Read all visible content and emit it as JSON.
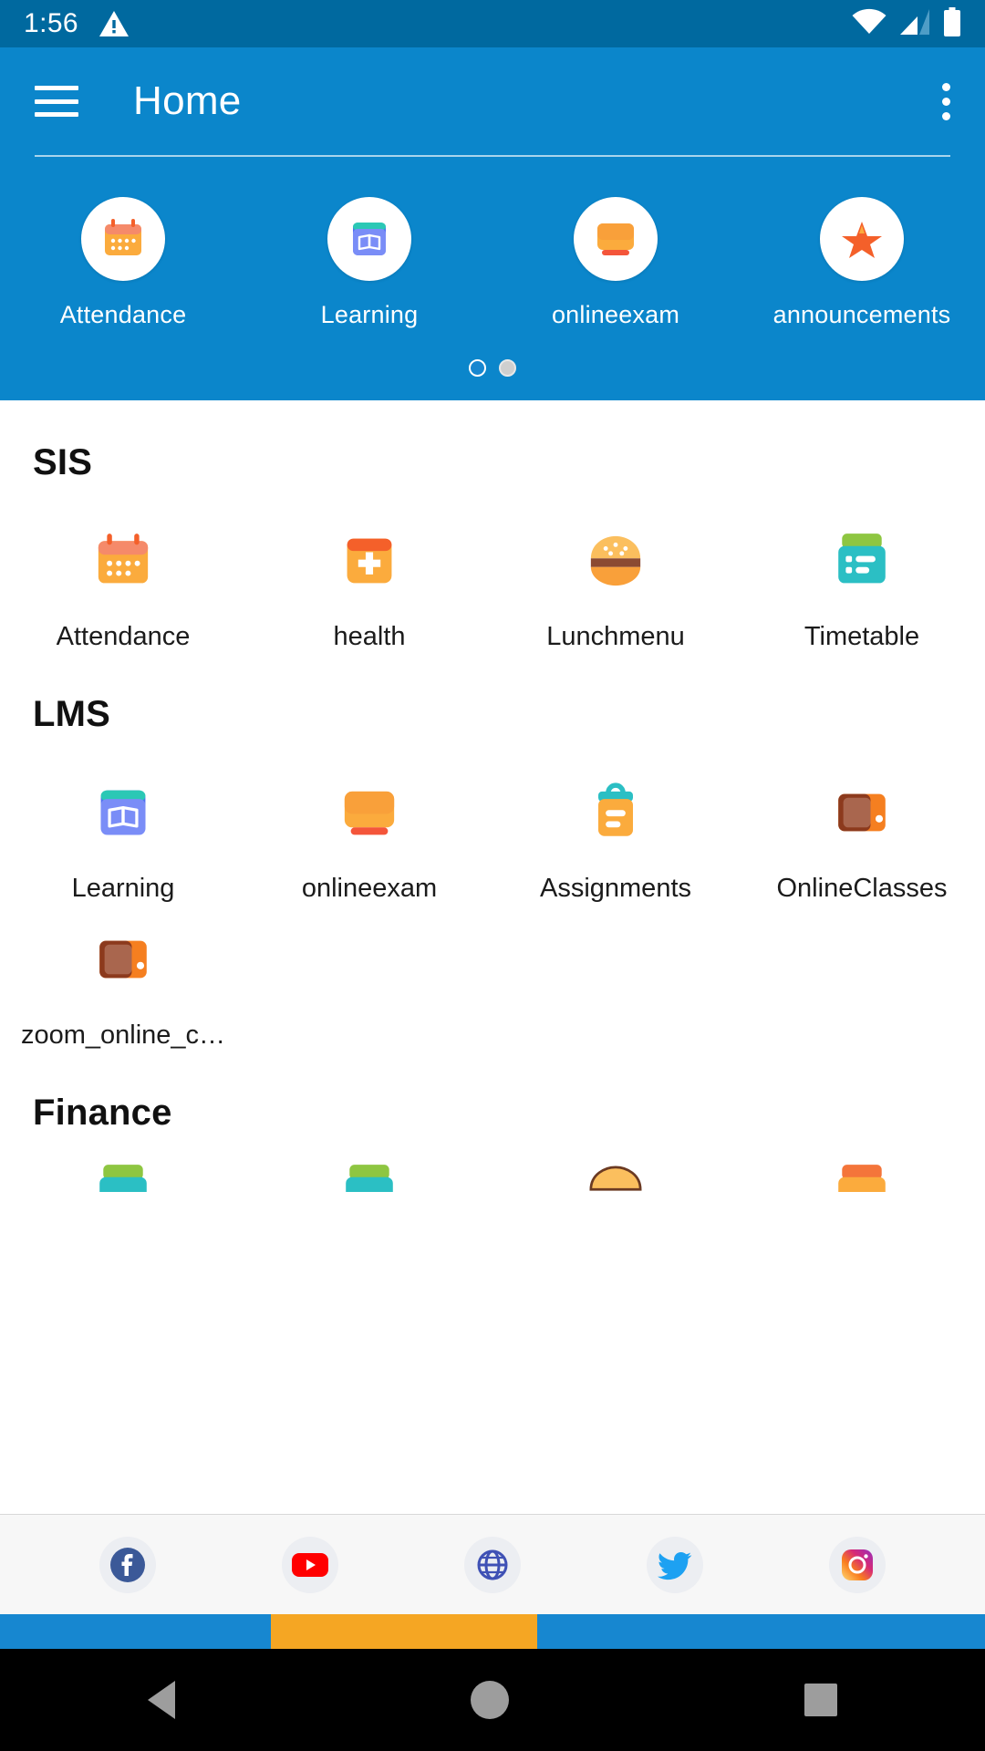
{
  "status_bar": {
    "time": "1:56",
    "icons": [
      "warning-triangle-icon",
      "wifi-icon",
      "signal-icon",
      "battery-icon"
    ],
    "background": "#00699f"
  },
  "app_bar": {
    "title": "Home",
    "menu_icon": "hamburger-menu-icon",
    "overflow_icon": "more-vertical-icon",
    "background": "#0b86cb"
  },
  "carousel": {
    "items": [
      {
        "label": "Attendance",
        "icon": "calendar-icon"
      },
      {
        "label": "Learning",
        "icon": "book-icon"
      },
      {
        "label": "onlineexam",
        "icon": "monitor-icon"
      },
      {
        "label": "announcements",
        "icon": "star-icon"
      }
    ],
    "pager": {
      "count": 2,
      "active_index": 0,
      "active_color": "#1787d0",
      "inactive_color": "#cfcfcf"
    }
  },
  "sections": [
    {
      "title": "SIS",
      "items": [
        {
          "label": "Attendance",
          "icon": "calendar-icon"
        },
        {
          "label": "health",
          "icon": "medical-cross-icon"
        },
        {
          "label": "Lunchmenu",
          "icon": "burger-icon"
        },
        {
          "label": "Timetable",
          "icon": "timetable-card-icon"
        }
      ]
    },
    {
      "title": "LMS",
      "items": [
        {
          "label": "Learning",
          "icon": "book-icon"
        },
        {
          "label": "onlineexam",
          "icon": "monitor-icon"
        },
        {
          "label": "Assignments",
          "icon": "clipboard-icon"
        },
        {
          "label": "OnlineClasses",
          "icon": "briefcase-icon"
        },
        {
          "label": "zoom_online_c…",
          "icon": "briefcase-icon"
        }
      ]
    },
    {
      "title": "Finance",
      "items": [
        {
          "label": "",
          "icon": "green-card-icon"
        },
        {
          "label": "",
          "icon": "green-card-icon"
        },
        {
          "label": "",
          "icon": "burger-icon"
        },
        {
          "label": "",
          "icon": "orange-card-icon"
        }
      ]
    }
  ],
  "social_bar": {
    "items": [
      {
        "name": "facebook-icon",
        "color": "#3b5998"
      },
      {
        "name": "youtube-icon",
        "color": "#ff0000"
      },
      {
        "name": "website-icon",
        "color": "#3f51b5"
      },
      {
        "name": "twitter-icon",
        "color": "#1da1f2"
      },
      {
        "name": "instagram-icon",
        "color": "#e1306c"
      }
    ]
  },
  "color_strip": {
    "left": "#1787d0",
    "middle": "#f5a623",
    "right": "#1787d0"
  },
  "nav_bar": {
    "back": "back-triangle-icon",
    "home": "home-circle-icon",
    "recents": "recents-square-icon"
  }
}
